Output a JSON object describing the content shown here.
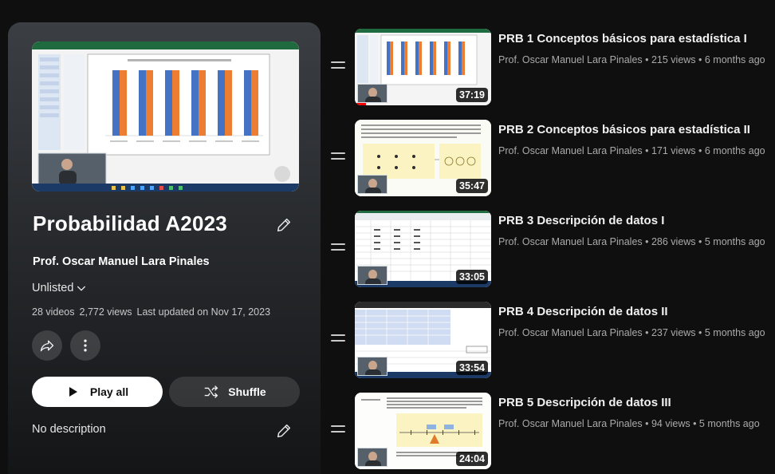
{
  "playlist": {
    "title": "Probabilidad A2023",
    "author": "Prof. Oscar Manuel Lara Pinales",
    "privacy": "Unlisted",
    "video_count": "28 videos",
    "views": "2,772 views",
    "last_updated": "Last updated on Nov 17, 2023",
    "play_all_label": "Play all",
    "shuffle_label": "Shuffle",
    "description": "No description"
  },
  "videos": [
    {
      "title": "PRB 1 Conceptos básicos para estadística I",
      "meta": "Prof. Oscar Manuel Lara Pinales • 215 views • 6 months ago",
      "duration": "37:19"
    },
    {
      "title": "PRB 2 Conceptos básicos para estadística II",
      "meta": "Prof. Oscar Manuel Lara Pinales • 171 views • 6 months ago",
      "duration": "35:47"
    },
    {
      "title": "PRB 3 Descripción de datos I",
      "meta": "Prof. Oscar Manuel Lara Pinales • 286 views • 5 months ago",
      "duration": "33:05"
    },
    {
      "title": "PRB 4 Descripción de datos II",
      "meta": "Prof. Oscar Manuel Lara Pinales • 237 views • 5 months ago",
      "duration": "33:54"
    },
    {
      "title": "PRB 5 Descripción de datos III",
      "meta": "Prof. Oscar Manuel Lara Pinales • 94 views • 5 months ago",
      "duration": "24:04"
    }
  ],
  "icons": {
    "edit": "pencil-icon",
    "privacy_toggle": "chevron-down-icon",
    "share": "share-icon",
    "more": "more-vert-icon",
    "play": "play-icon",
    "shuffle": "shuffle-icon",
    "drag": "drag-handle-icon"
  },
  "colors": {
    "background": "#0f0f0f",
    "bar_blue": "#4472c4",
    "bar_orange": "#ed7d31",
    "progress": "#ff0000"
  }
}
